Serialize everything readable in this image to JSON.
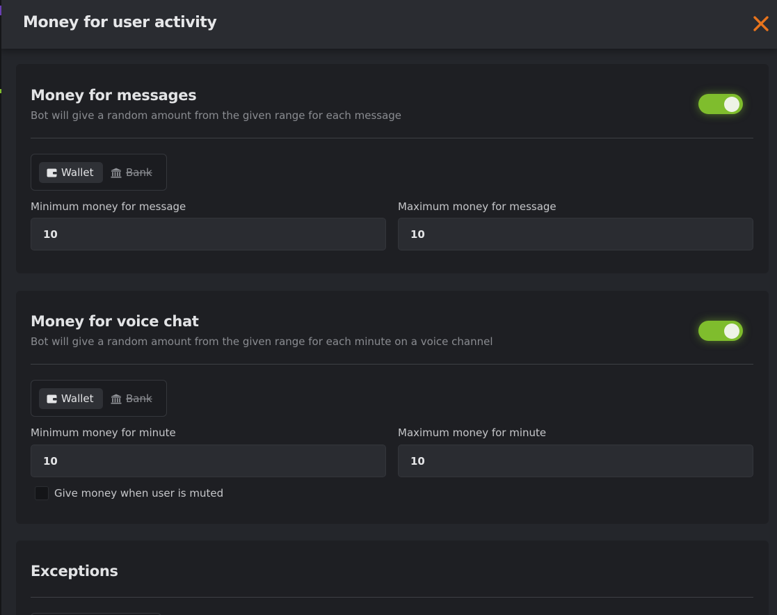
{
  "modal": {
    "title": "Money for user activity",
    "close_icon": "close-icon",
    "accent_color": "#e8741c"
  },
  "messages": {
    "title": "Money for messages",
    "description": "Bot will give a random amount from the given range for each message",
    "enabled": true,
    "toggle_color": "#7fbd2d",
    "target": {
      "wallet_label": "Wallet",
      "bank_label": "Bank",
      "selected": "Wallet"
    },
    "min_label": "Minimum money for message",
    "min_value": "10",
    "max_label": "Maximum money for message",
    "max_value": "10"
  },
  "voice": {
    "title": "Money for voice chat",
    "description": "Bot will give a random amount from the given range for each minute on a voice channel",
    "enabled": true,
    "target": {
      "wallet_label": "Wallet",
      "bank_label": "Bank",
      "selected": "Wallet"
    },
    "min_label": "Minimum money for minute",
    "min_value": "10",
    "max_label": "Maximum money for minute",
    "max_value": "10",
    "muted_label": "Give money when user is muted",
    "muted_checked": false
  },
  "exceptions": {
    "title": "Exceptions"
  },
  "icons": {
    "wallet": "wallet-icon",
    "bank": "bank-icon"
  }
}
